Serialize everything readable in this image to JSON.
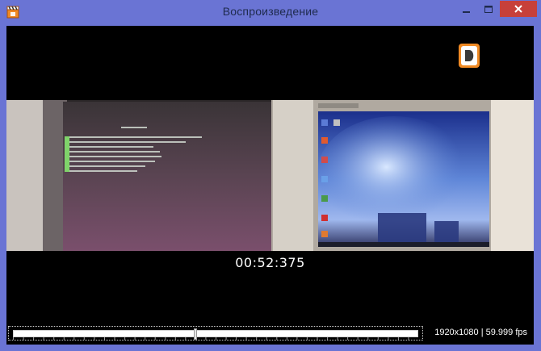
{
  "window": {
    "title": "Воспроизведение",
    "accent_color": "#6a74d4",
    "close_color": "#c7403a"
  },
  "icons": {
    "app": "film-clapper-icon",
    "minimize": "minimize-icon",
    "maximize": "maximize-icon",
    "close": "close-icon",
    "watermark": "d-logo-icon"
  },
  "player": {
    "timecode": "00:52:375",
    "resolution_fps": "1920x1080 | 59.999 fps",
    "position_fraction": 0.45
  }
}
